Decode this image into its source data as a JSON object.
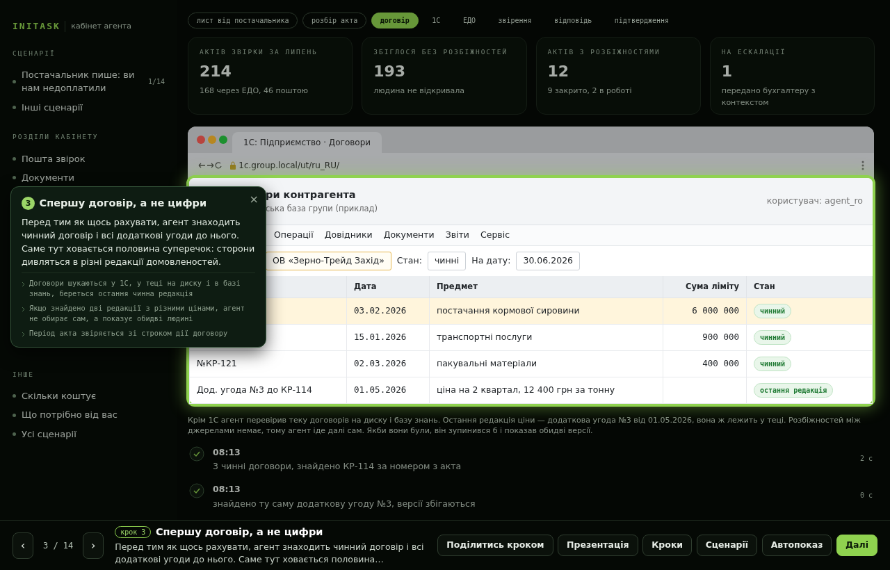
{
  "brand": {
    "name": "INITASK",
    "subtitle": "кабінет агента"
  },
  "sidebar": {
    "sections": [
      {
        "title": "СЦЕНАРІЇ",
        "items": [
          {
            "label": "Постачальник пише: ви нам недоплатили",
            "count": "1/14"
          },
          {
            "label": "Інші сценарії"
          }
        ]
      },
      {
        "title": "РОЗДІЛИ КАБІНЕТУ",
        "items": [
          {
            "label": "Пошта звірок"
          },
          {
            "label": "Документи"
          }
        ]
      },
      {
        "title": "ІНШЕ",
        "items": [
          {
            "label": "Скільки коштує"
          },
          {
            "label": "Що потрібно від вас"
          },
          {
            "label": "Усі сценарії"
          }
        ]
      }
    ]
  },
  "step_tabs": [
    {
      "label": "лист від постачальника",
      "selected": false
    },
    {
      "label": "розбір акта",
      "selected": false
    },
    {
      "label": "договір",
      "selected": true
    },
    {
      "label": "1С",
      "selected": false
    },
    {
      "label": "ЕДО",
      "selected": false
    },
    {
      "label": "звірення",
      "selected": false
    },
    {
      "label": "відповідь",
      "selected": false
    },
    {
      "label": "підтвердження",
      "selected": false
    }
  ],
  "stats": [
    {
      "label": "АКТІВ ЗВІРКИ ЗА ЛИПЕНЬ",
      "value": "214",
      "note": "168 через ЕДО, 46 поштою"
    },
    {
      "label": "ЗБІГЛОСЯ БЕЗ РОЗБІЖНОСТЕЙ",
      "value": "193",
      "note": "людина не відкривала"
    },
    {
      "label": "АКТІВ З РОЗБІЖНОСТЯМИ",
      "value": "12",
      "note": "9 закрито, 2 в роботі"
    },
    {
      "label": "НА ЕСКАЛАЦІЇ",
      "value": "1",
      "note": "передано бухгалтеру з контекстом"
    }
  ],
  "browser": {
    "tab_title": "1С: Підприємство · Договори",
    "url": "1c.group.local/ut/ru_RU/"
  },
  "app": {
    "title": "ри контрагента",
    "subtitle": "ська база групи (приклад)",
    "user": "користувач: agent_ro",
    "menu": [
      "Операції",
      "Довідники",
      "Документи",
      "Звіти",
      "Сервіс"
    ],
    "filters": {
      "counterparty": "ОВ «Зерно-Трейд Захід»",
      "state_label": "Стан:",
      "state": "чинні",
      "date_label": "На дату:",
      "date": "30.06.2026"
    },
    "columns": [
      "Дата",
      "Предмет",
      "Сума ліміту",
      "Стан"
    ],
    "rows": [
      {
        "date": "03.02.2026",
        "subject": "постачання кормової сировини",
        "amount": "6 000 000",
        "status": "чинний",
        "highlighted": true
      },
      {
        "date": "15.01.2026",
        "subject": "транспортні послуги",
        "amount": "900 000",
        "status": "чинний",
        "highlighted": false
      },
      {
        "column_1": "№КР-121",
        "date": "02.03.2026",
        "subject": "пакувальні матеріали",
        "amount": "400 000",
        "status": "чинний",
        "highlighted": false
      },
      {
        "column_1": "Дод. угода №3 до КР-114",
        "date": "01.05.2026",
        "subject": "ціна на 2 квартал, 12 400 грн за тонну",
        "status": "остання редакція",
        "highlighted": false
      }
    ]
  },
  "timeline": {
    "note": "Крім 1С агент перевірив теку договорів на диску і базу знань. Остання редакція ціни — додаткова угода №3 від 01.05.2026, вона ж лежить у теці. Розбіжностей між джерелами немає, тому агент іде далі сам. Якби вони були, він зупинився б і показав обидві версії.",
    "events": [
      {
        "time": "08:13",
        "text": "3 чинні договори, знайдено КР-114 за номером з акта",
        "duration": "2 с"
      },
      {
        "time": "08:13",
        "text": "знайдено ту саму додаткову угоду №3, версії збігаються",
        "duration": "0 с"
      }
    ]
  },
  "tour": {
    "step": "3",
    "title": "Спершу договір, а не цифри",
    "close": "×",
    "body": "Перед тим як щось рахувати, агент знаходить чинний договір і всі додаткові угоди до нього. Саме тут ховається половина суперечок: сторони дивляться в різні редакції домовленостей.",
    "bullets": [
      "Договори шукаються у 1С, у теці на диску і в базі знань, береться остання чинна редакція",
      "Якщо знайдено дві редакції з різними цінами, агент не обирає сам, а показує обидві людині",
      "Період акта звіряється зі строком дії договору"
    ]
  },
  "footer": {
    "prev": "‹",
    "next": "›",
    "counter": "3 / 14",
    "step_badge": "крок 3",
    "title": "Спершу договір, а не цифри",
    "text": "Перед тим як щось рахувати, агент знаходить чинний договір і всі додаткові угоди до нього. Саме тут ховається половина…",
    "buttons": [
      {
        "label": "Поділитись кроком",
        "primary": false
      },
      {
        "label": "Презентація",
        "primary": false
      },
      {
        "label": "Кроки",
        "primary": false
      },
      {
        "label": "Сценарії",
        "primary": false
      },
      {
        "label": "Автопоказ",
        "primary": false
      },
      {
        "label": "Далі",
        "primary": true
      }
    ]
  }
}
